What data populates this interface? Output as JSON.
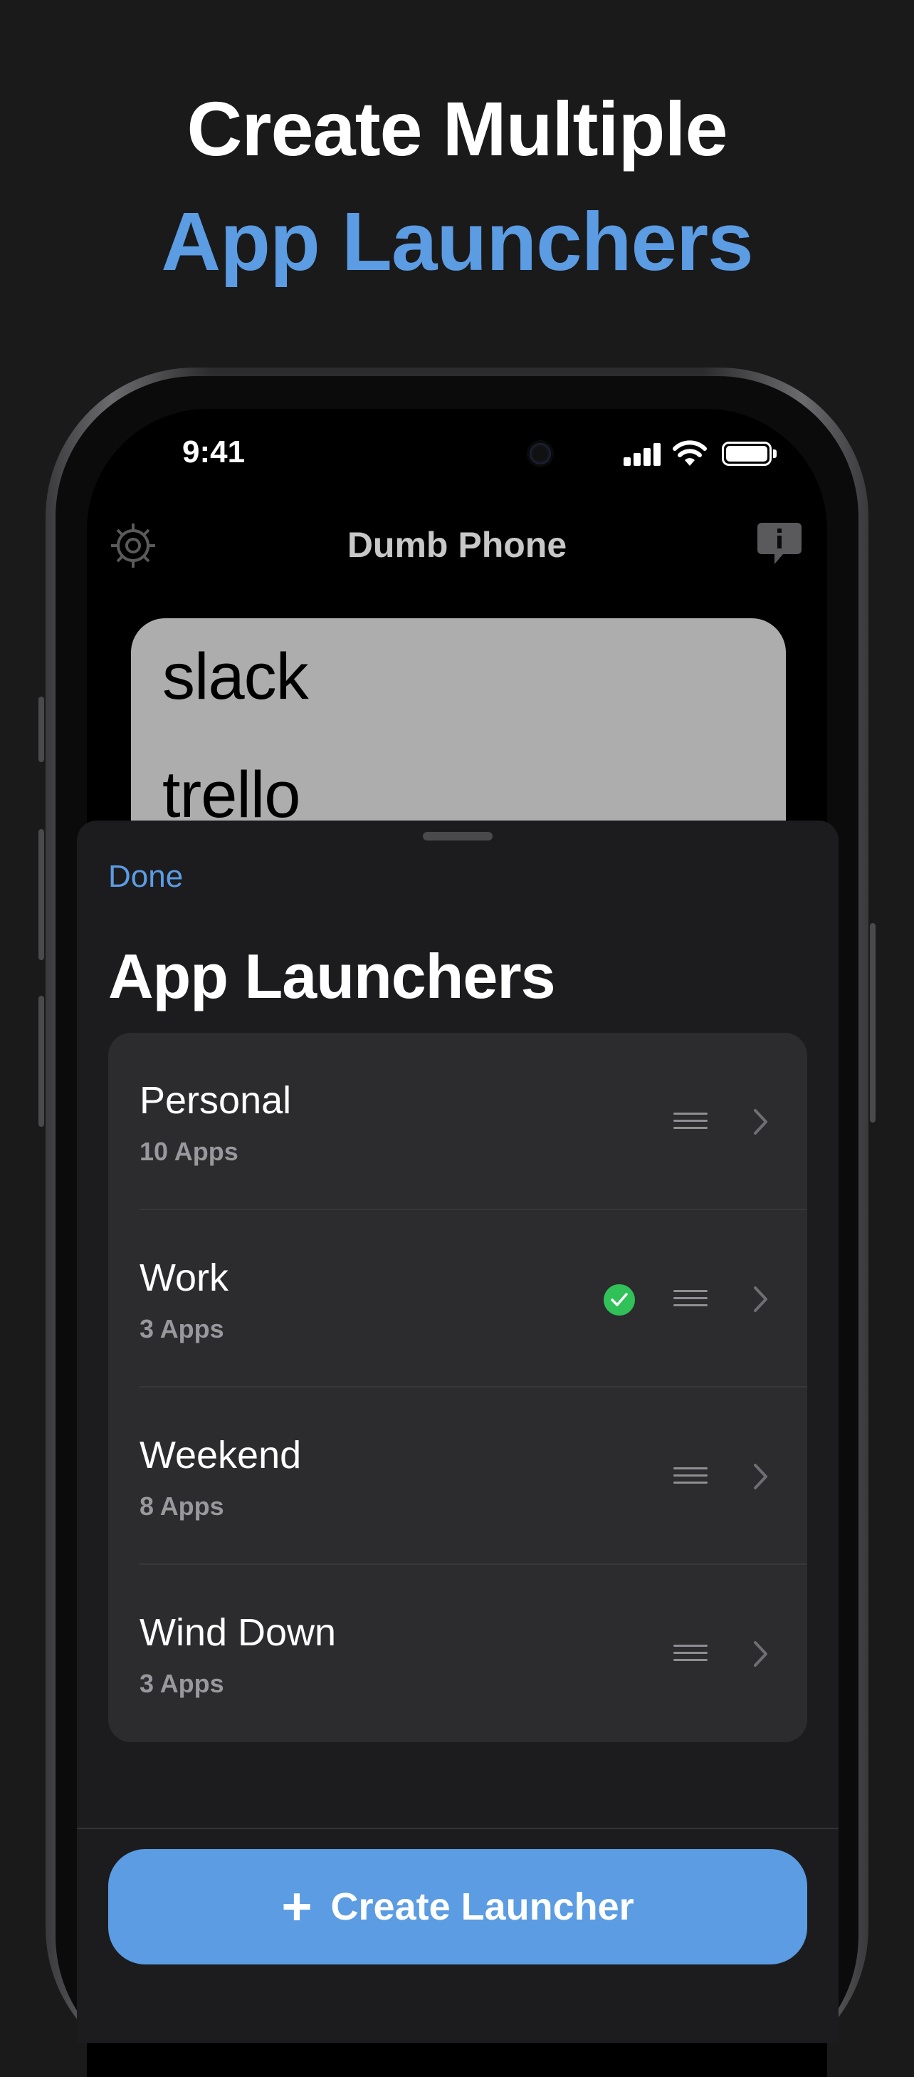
{
  "headline": {
    "line1": "Create Multiple",
    "line2": "App Launchers"
  },
  "status_bar": {
    "time": "9:41"
  },
  "app": {
    "title": "Dumb Phone",
    "settings_icon": "gear-icon",
    "info_icon": "info-bubble-icon"
  },
  "launcher_preview": {
    "apps": [
      "slack",
      "trello"
    ]
  },
  "sheet": {
    "done_label": "Done",
    "title": "App Launchers",
    "launchers": [
      {
        "name": "Personal",
        "count": "10 Apps",
        "active": false
      },
      {
        "name": "Work",
        "count": "3 Apps",
        "active": true
      },
      {
        "name": "Weekend",
        "count": "8 Apps",
        "active": false
      },
      {
        "name": "Wind Down",
        "count": "3 Apps",
        "active": false
      }
    ],
    "create_label": "Create Launcher"
  },
  "colors": {
    "accent": "#5b9ce3",
    "active_check": "#30c158",
    "background": "#1a1a1b"
  }
}
